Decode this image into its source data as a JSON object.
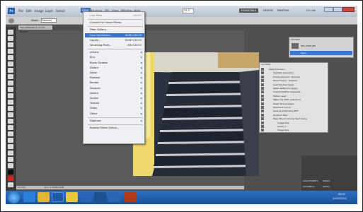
{
  "menubar": {
    "items": [
      "File",
      "Edit",
      "Image",
      "Layer",
      "Select",
      "Filter",
      "Analysis",
      "3D",
      "View",
      "Window",
      "Help"
    ],
    "zoom": "33.3",
    "workspaces": [
      "ESSENTIALS",
      "DESIGN",
      "PAINTING"
    ],
    "cs_live": "CS Live"
  },
  "optionsbar": {
    "mode_label": "Mode:",
    "mode_value": "Normal"
  },
  "document": {
    "tab": "IMG_0908.JPG @ 33.3% (RGB/8)"
  },
  "filter_menu": {
    "items": [
      {
        "label": "Last Filter",
        "shortcut": "Ctrl+F",
        "state": "dim"
      },
      {
        "label": "Convert for Smart Filters",
        "shortcut": "",
        "state": ""
      },
      {
        "label": "Filter Gallery...",
        "shortcut": "",
        "state": ""
      },
      {
        "label": "Lens Correction...",
        "shortcut": "Shift+Ctrl+R",
        "state": "hl"
      },
      {
        "label": "Liquify...",
        "shortcut": "Shift+Ctrl+X",
        "state": ""
      },
      {
        "label": "Vanishing Point...",
        "shortcut": "Alt+Ctrl+V",
        "state": ""
      },
      {
        "label": "Artistic",
        "sub": true
      },
      {
        "label": "Blur",
        "sub": true
      },
      {
        "label": "Brush Strokes",
        "sub": true
      },
      {
        "label": "Distort",
        "sub": true
      },
      {
        "label": "Noise",
        "sub": true
      },
      {
        "label": "Pixelate",
        "sub": true
      },
      {
        "label": "Render",
        "sub": true
      },
      {
        "label": "Sharpen",
        "sub": true
      },
      {
        "label": "Sketch",
        "sub": true
      },
      {
        "label": "Stylize",
        "sub": true
      },
      {
        "label": "Texture",
        "sub": true
      },
      {
        "label": "Video",
        "sub": true
      },
      {
        "label": "Other",
        "sub": true
      },
      {
        "label": "Digimarc",
        "sub": true
      },
      {
        "label": "Browse Filters Online...",
        "shortcut": "",
        "state": ""
      }
    ]
  },
  "history_panel": {
    "title": "HISTORY",
    "snapshot": "IMG_0908.JPG",
    "state": "Open"
  },
  "actions_panel": {
    "title": "ACTIONS",
    "rows": [
      "Default Actions",
      "Vignette (selection)",
      "Frame Channel - 50 pixel",
      "Wood Frame - 50 pixel",
      "Cast Shadow (type)",
      "Water Reflection (type)",
      "Custom RGB to Grayscale",
      "Molten Lead",
      "Make Clip Path (selection)",
      "Sepia Toning (layer)",
      "Quadrant Colors",
      "Save As Photoshop PDF",
      "Gradient Map",
      "Mixer Brush Cloning Paint Setup",
      "Image Size",
      "Action 1",
      "Image Size"
    ]
  },
  "status": {
    "zoom": "33.33%",
    "doc": "Doc: 5.84M/5.84M"
  },
  "dock": {
    "tab1": "ADJUSTMENTS",
    "tab2": "MASKS",
    "tab3": "CHANNELS",
    "tab4": "PATHS"
  },
  "taskbar": {
    "time": "09:47",
    "date": "24/02/2012"
  },
  "colors": {
    "highlight": "#3876cc",
    "taskbar": "#1f5aa8"
  }
}
